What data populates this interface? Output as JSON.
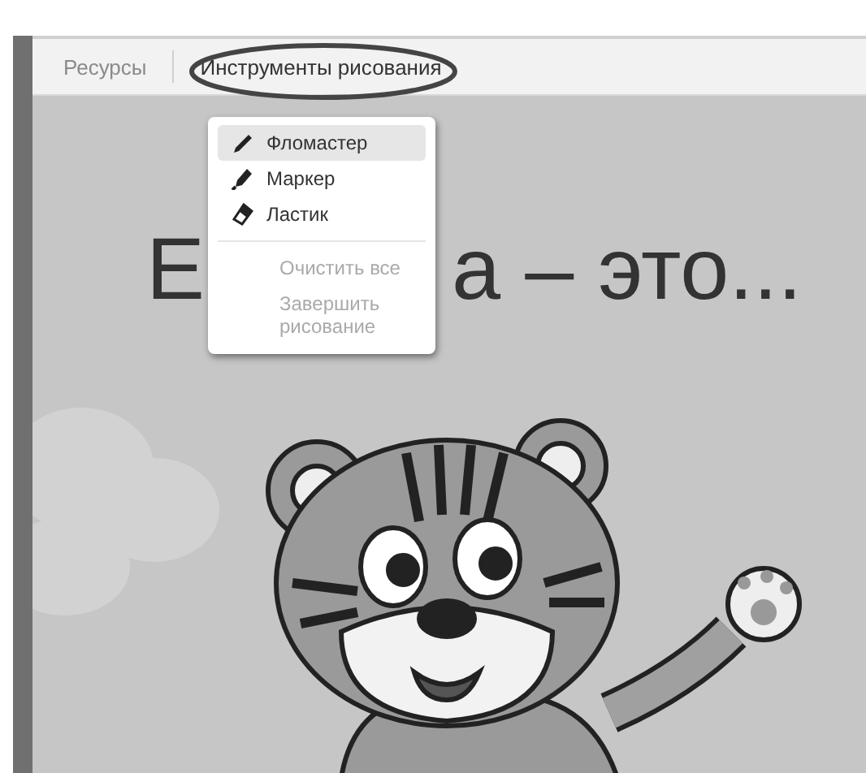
{
  "toolbar": {
    "tabs": [
      {
        "label": "Ресурсы",
        "selected": false
      },
      {
        "label": "Инструменты рисования",
        "selected": true
      }
    ]
  },
  "menu": {
    "items": [
      {
        "kind": "pen",
        "label": "Фломастер",
        "selected": true,
        "disabled": false
      },
      {
        "kind": "marker",
        "label": "Маркер",
        "selected": false,
        "disabled": false
      },
      {
        "kind": "eraser",
        "label": "Ластик",
        "selected": false,
        "disabled": false
      },
      {
        "kind": "action",
        "label": "Очистить все",
        "selected": false,
        "disabled": true
      },
      {
        "kind": "action",
        "label": "Завершить рисование",
        "selected": false,
        "disabled": true
      }
    ]
  },
  "slide": {
    "title_parts": [
      "Е",
      "а – это..."
    ]
  }
}
